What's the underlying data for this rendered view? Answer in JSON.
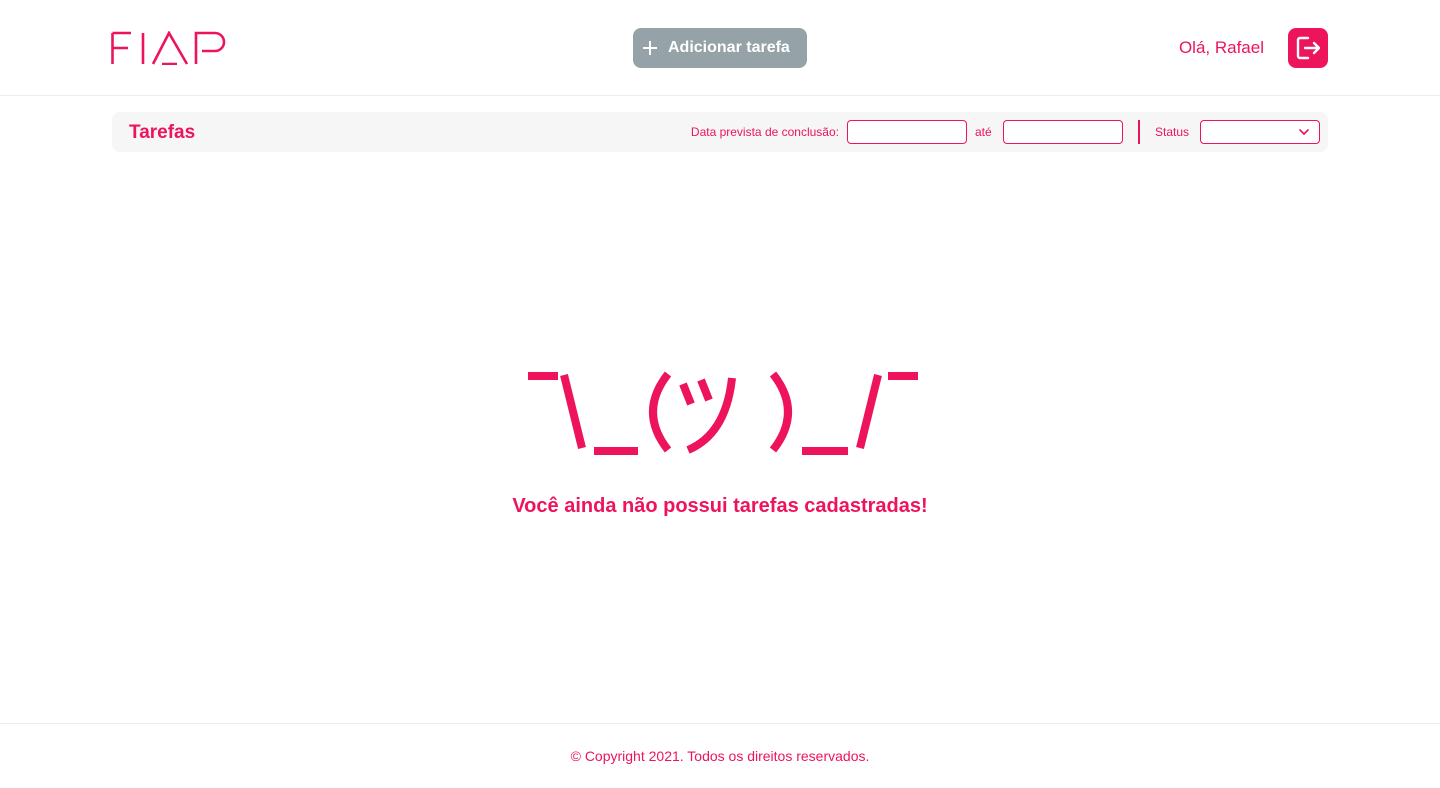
{
  "colors": {
    "accent": "#ED145B",
    "button_disabled": "#95a3a8",
    "filter_bg": "#f6f6f7"
  },
  "header": {
    "logo_text": "FIAP",
    "add_task_label": "Adicionar tarefa",
    "add_task_icon": "plus-icon",
    "greeting": "Olá, Rafael",
    "logout_icon": "logout-icon"
  },
  "filters": {
    "title": "Tarefas",
    "date_label": "Data prevista de conclusão:",
    "date_from_value": "",
    "date_to_label": "até",
    "date_to_value": "",
    "status_label": "Status",
    "status_selected": "",
    "status_icon": "chevron-down-icon"
  },
  "empty_state": {
    "emoticon": "¯\\_(ツ)_/¯",
    "message": "Você ainda não possui tarefas cadastradas!"
  },
  "footer": {
    "copyright": "© Copyright 2021. Todos os direitos reservados."
  }
}
